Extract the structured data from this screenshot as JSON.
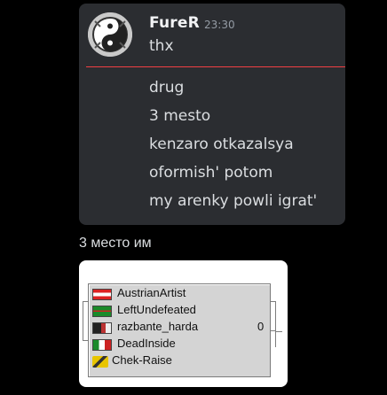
{
  "message": {
    "author": "FureR",
    "timestamp": "23:30",
    "first_line": "thx",
    "lines": [
      "drug",
      "3 mesto",
      "kenzaro otkazalsya",
      "oformish' potom",
      "my arenky powli igrat'"
    ]
  },
  "caption": "3 место им",
  "bracket": {
    "teams": [
      {
        "name": "AustrianArtist",
        "flag": "austria-flag-icon"
      },
      {
        "name": "LeftUndefeated",
        "flag": "green-flag-icon"
      },
      {
        "name": "razbante_harda",
        "flag": "dark-flag-icon"
      },
      {
        "name": "DeadInside",
        "flag": "italy-flag-icon"
      },
      {
        "name": "Chek-Raise",
        "flag": "yellow-icon"
      }
    ],
    "score": "0"
  },
  "colors": {
    "background": "#000000",
    "card": "#2b2d31",
    "divider": "#f23f43",
    "text": "#dbdee1",
    "muted": "#949ba4"
  }
}
